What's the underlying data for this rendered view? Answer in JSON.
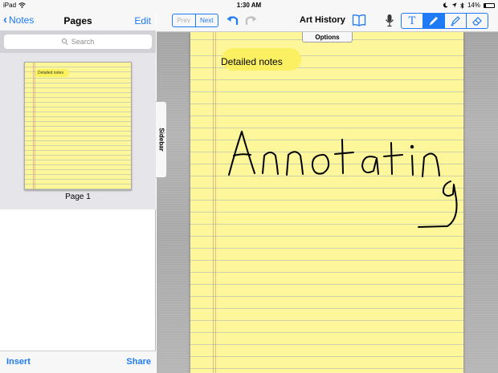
{
  "status_bar": {
    "device": "iPad",
    "time": "1:30 AM",
    "battery": "14%"
  },
  "sidebar": {
    "back_label": "Notes",
    "title": "Pages",
    "edit_label": "Edit",
    "search_placeholder": "Search",
    "pages": [
      {
        "label": "Page 1",
        "preview_text": "Detailed notes"
      }
    ],
    "insert_label": "Insert",
    "share_label": "Share",
    "tab_label": "Sidebar"
  },
  "toolbar": {
    "prev_label": "Prev",
    "next_label": "Next",
    "title": "Art History",
    "tools": [
      "text-tool-icon",
      "pen-tool-icon",
      "highlighter-tool-icon",
      "eraser-tool-icon"
    ],
    "active_tool": "pen"
  },
  "canvas": {
    "options_label": "Options",
    "typed_text": "Detailed notes",
    "handwritten_text": "Annotating"
  },
  "colors": {
    "accent": "#1f7af5",
    "paper": "#fdf69a",
    "highlight": "#fbf061"
  }
}
